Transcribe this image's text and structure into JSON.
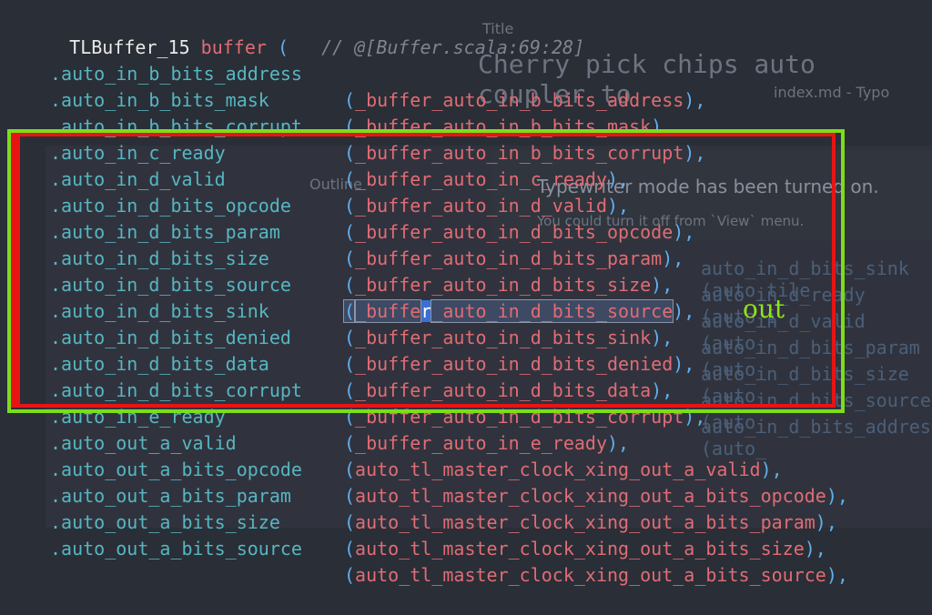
{
  "header": {
    "instance": "TLBuffer_15",
    "name": "buffer",
    "paren": "(",
    "comment": "// @[Buffer.scala:69:28]"
  },
  "lines": [
    {
      "port": ".auto_in_b_bits_address",
      "arg_open": "(",
      "arg": "_buffer_auto_in_b_bits_address",
      "arg_close": "),"
    },
    {
      "port": ".auto_in_b_bits_mask",
      "arg_open": "(",
      "arg": "_buffer_auto_in_b_bits_mask",
      "arg_close": "),"
    },
    {
      "port": ".auto_in_b_bits_corrupt",
      "arg_open": "(",
      "arg": "_buffer_auto_in_b_bits_corrupt",
      "arg_close": "),"
    },
    {
      "port": ".auto_in_c_ready",
      "arg_open": "(",
      "arg": "_buffer_auto_in_c_ready",
      "arg_close": "),"
    },
    {
      "port": ".auto_in_d_valid",
      "arg_open": "(",
      "arg": "_buffer_auto_in_d_valid",
      "arg_close": "),"
    },
    {
      "port": ".auto_in_d_bits_opcode",
      "arg_open": "(",
      "arg": "_buffer_auto_in_d_bits_opcode",
      "arg_close": "),"
    },
    {
      "port": ".auto_in_d_bits_param",
      "arg_open": "(",
      "arg": "_buffer_auto_in_d_bits_param",
      "arg_close": "),"
    },
    {
      "port": ".auto_in_d_bits_size",
      "arg_open": "(",
      "arg": "_buffer_auto_in_d_bits_size",
      "arg_close": "),"
    },
    {
      "port": ".auto_in_d_bits_source",
      "arg_open": "(",
      "arg_pre": "_buffe",
      "arg_cursor": "r",
      "arg_post": "_auto_in_d_bits_source",
      "arg_close": "),"
    },
    {
      "port": ".auto_in_d_bits_sink",
      "arg_open": "(",
      "arg": "_buffer_auto_in_d_bits_sink",
      "arg_close": "),"
    },
    {
      "port": ".auto_in_d_bits_denied",
      "arg_open": "(",
      "arg": "_buffer_auto_in_d_bits_denied",
      "arg_close": "),"
    },
    {
      "port": ".auto_in_d_bits_data",
      "arg_open": "(",
      "arg": "_buffer_auto_in_d_bits_data",
      "arg_close": "),"
    },
    {
      "port": ".auto_in_d_bits_corrupt",
      "arg_open": "(",
      "arg": "_buffer_auto_in_d_bits_corrupt",
      "arg_close": "),"
    },
    {
      "port": ".auto_in_e_ready",
      "arg_open": "(",
      "arg": "_buffer_auto_in_e_ready",
      "arg_close": "),"
    },
    {
      "port": ".auto_out_a_valid",
      "arg_open": "(",
      "arg": "auto_tl_master_clock_xing_out_a_valid",
      "arg_close": "),"
    },
    {
      "port": ".auto_out_a_bits_opcode",
      "arg_open": "(",
      "arg": "auto_tl_master_clock_xing_out_a_bits_opcode",
      "arg_close": "),"
    },
    {
      "port": ".auto_out_a_bits_param",
      "arg_open": "(",
      "arg": "auto_tl_master_clock_xing_out_a_bits_param",
      "arg_close": "),"
    },
    {
      "port": ".auto_out_a_bits_size",
      "arg_open": "(",
      "arg": "auto_tl_master_clock_xing_out_a_bits_size",
      "arg_close": "),"
    },
    {
      "port": ".auto_out_a_bits_source",
      "arg_open": "(",
      "arg": "auto_tl_master_clock_xing_out_a_bits_source",
      "arg_close": "),"
    }
  ],
  "annotation": {
    "label": "out",
    "red_color": "#e81414",
    "green_color": "#7bde19"
  },
  "ghost": {
    "title": "Title",
    "heading": "Cherry pick chips auto coupler to",
    "file": "index.md - Typo",
    "outline": "Outline",
    "notice": "Typewriter mode has been turned on.",
    "notice_sub": "You could turn it off from `View` menu.",
    "right_lines": [
      "auto_in_d_bits_sink  (auto_tile",
      "auto_in_d_ready      (auto_i",
      "auto_in_d_valid      (auto_",
      "auto_in_d_bits_param (auto_",
      "auto_in_d_bits_size  (auto_",
      "auto_in_d_bits_source (auto_",
      "auto_in_d_bits_address (auto_"
    ]
  }
}
